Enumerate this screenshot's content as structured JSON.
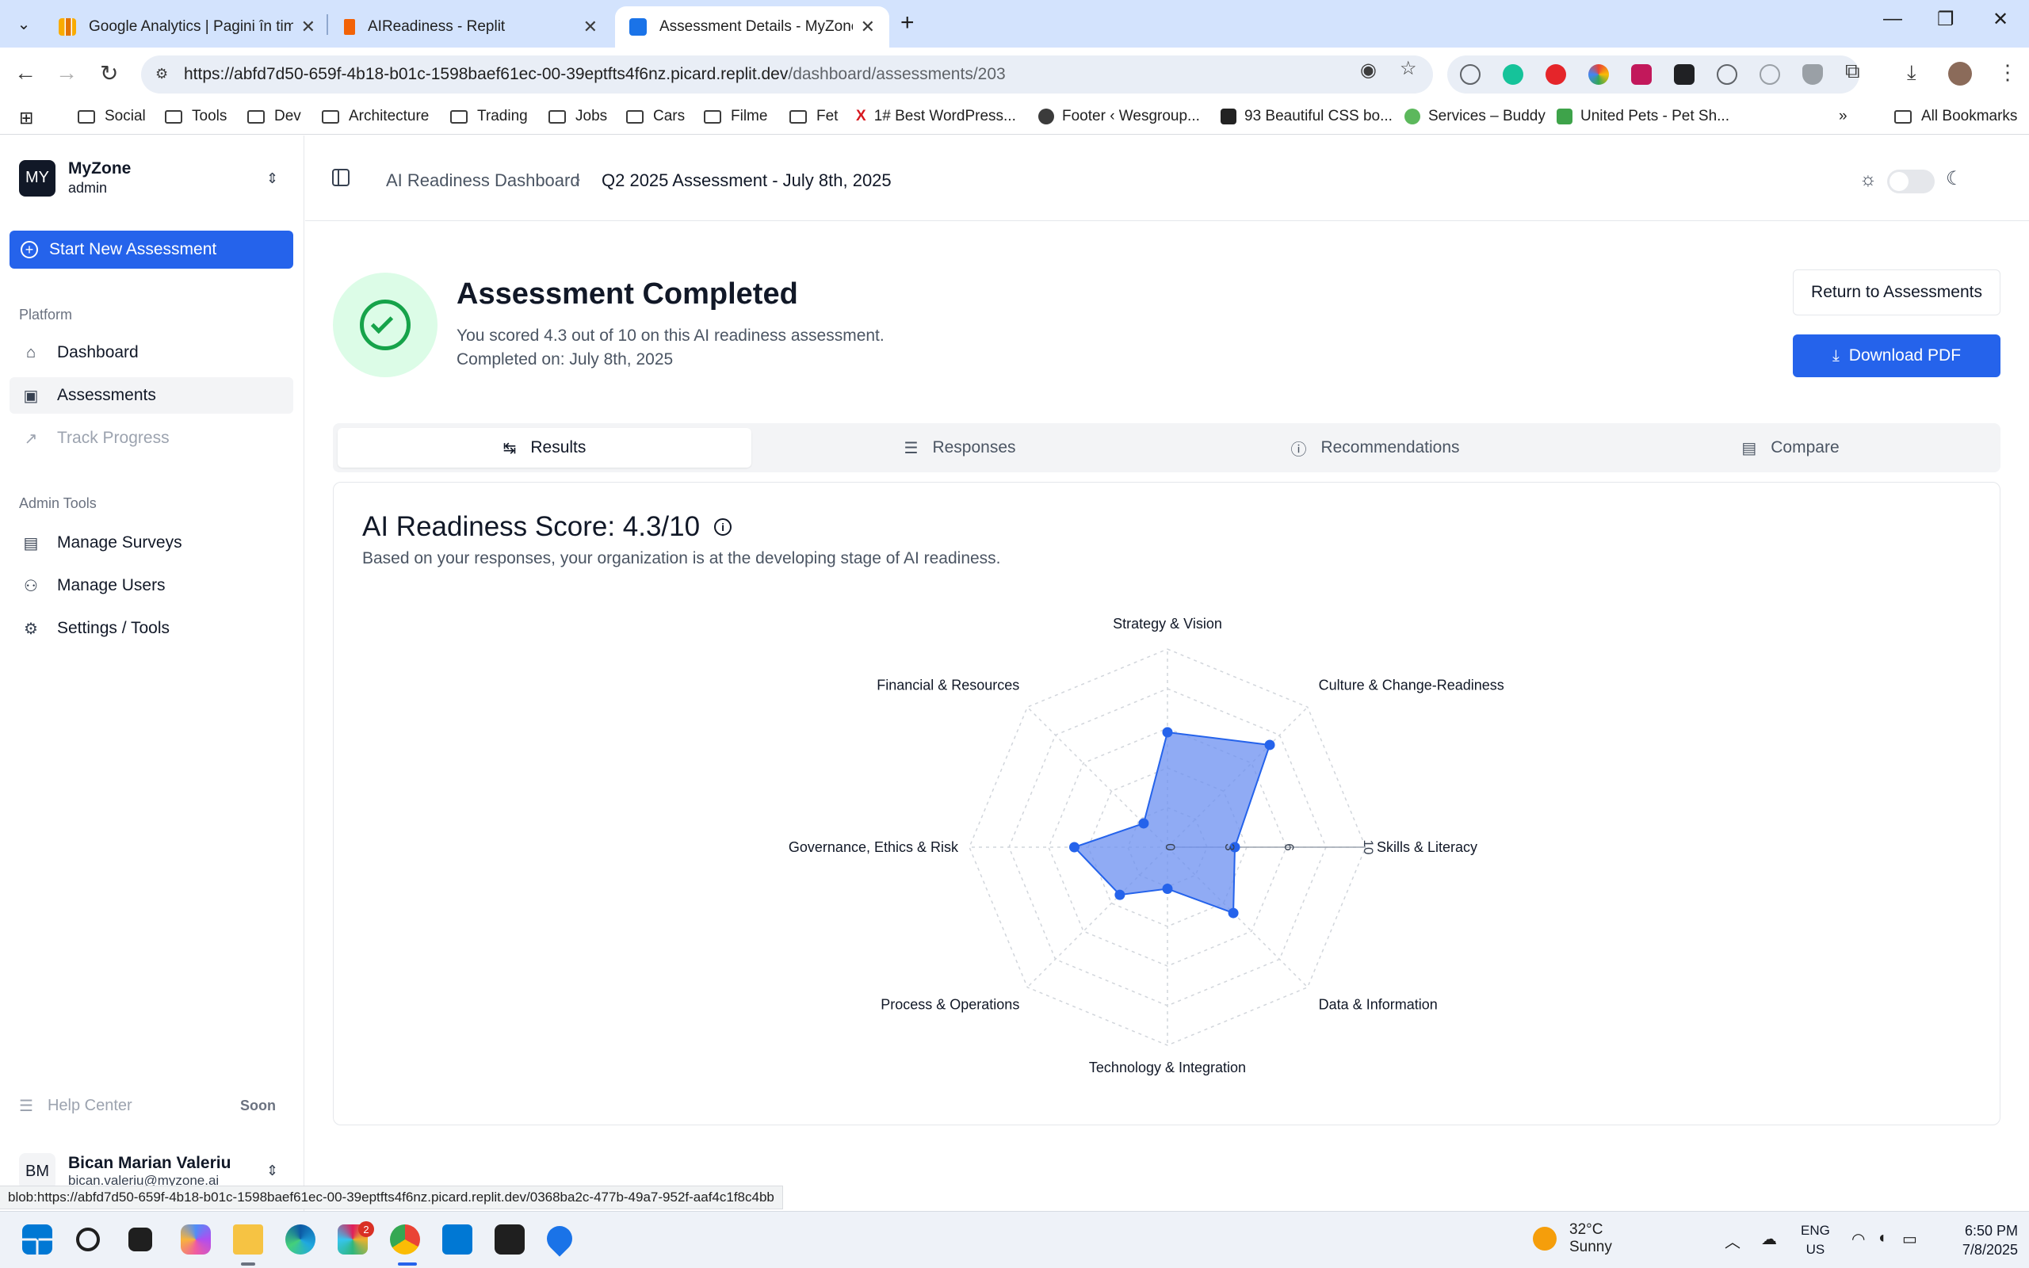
{
  "browser": {
    "tabs": [
      {
        "title": "Google Analytics | Pagini în tim",
        "favicon_color": "#f9ab00"
      },
      {
        "title": "AIReadiness - Replit",
        "favicon_color": "#f26207"
      },
      {
        "title": "Assessment Details - MyZone A",
        "favicon_color": "#1a73e8"
      }
    ],
    "url_host": "https://abfd7d50-659f-4b18-b01c-1598baef61ec-00-39eptfts4f6nz.picard.replit.dev",
    "url_path": "/dashboard/assessments/203",
    "bookmarks": [
      {
        "label": "Social",
        "type": "folder"
      },
      {
        "label": "Tools",
        "type": "folder"
      },
      {
        "label": "Dev",
        "type": "folder"
      },
      {
        "label": "Architecture",
        "type": "folder"
      },
      {
        "label": "Trading",
        "type": "folder"
      },
      {
        "label": "Jobs",
        "type": "folder"
      },
      {
        "label": "Cars",
        "type": "folder"
      },
      {
        "label": "Filme",
        "type": "folder"
      },
      {
        "label": "Fet",
        "type": "folder"
      },
      {
        "label": "1# Best WordPress...",
        "type": "site",
        "color": "#d71920"
      },
      {
        "label": "Footer ‹ Wesgroup...",
        "type": "site",
        "color": "#3b3b3b"
      },
      {
        "label": "93 Beautiful CSS bo...",
        "type": "site",
        "color": "#222222"
      },
      {
        "label": "Services – Buddy",
        "type": "site",
        "color": "#5cb85c"
      },
      {
        "label": "United Pets - Pet Sh...",
        "type": "site",
        "color": "#3ea34a"
      }
    ],
    "all_bookmarks": "All Bookmarks"
  },
  "sidebar": {
    "org_initials": "MY",
    "org_name": "MyZone",
    "org_role": "admin",
    "start_button": "Start New Assessment",
    "platform_label": "Platform",
    "platform_items": [
      {
        "label": "Dashboard",
        "icon": "home-icon"
      },
      {
        "label": "Assessments",
        "icon": "clipboard-icon"
      },
      {
        "label": "Track Progress",
        "icon": "trend-icon"
      }
    ],
    "admin_label": "Admin Tools",
    "admin_items": [
      {
        "label": "Manage Surveys",
        "icon": "survey-icon"
      },
      {
        "label": "Manage Users",
        "icon": "users-icon"
      },
      {
        "label": "Settings / Tools",
        "icon": "gear-icon"
      }
    ],
    "help_label": "Help Center",
    "help_badge": "Soon",
    "user_initials": "BM",
    "user_name": "Bican Marian Valeriu",
    "user_email": "bican.valeriu@myzone.ai"
  },
  "header": {
    "crumb_parent": "AI Readiness Dashboard",
    "crumb_current": "Q2 2025 Assessment - July 8th, 2025"
  },
  "summary": {
    "title": "Assessment Completed",
    "score_line": "You scored 4.3 out of 10 on this AI readiness assessment.",
    "completed_line": "Completed on: July 8th, 2025",
    "return_button": "Return to Assessments",
    "download_button": "Download PDF"
  },
  "tabs": [
    {
      "label": "Results",
      "icon": "↹"
    },
    {
      "label": "Responses",
      "icon": "☰"
    },
    {
      "label": "Recommendations",
      "icon": "ⓘ"
    },
    {
      "label": "Compare",
      "icon": "▤"
    }
  ],
  "results": {
    "score_title": "AI Readiness Score: 4.3/10",
    "score_sub": "Based on your responses, your organization is at the developing stage of AI readiness."
  },
  "chart_data": {
    "type": "radar",
    "categories": [
      "Strategy & Vision",
      "Culture & Change-Readiness",
      "Skills & Literacy",
      "Data & Information",
      "Technology & Integration",
      "Process & Operations",
      "Governance, Ethics & Risk",
      "Financial & Resources"
    ],
    "values": [
      5.8,
      7.3,
      3.4,
      4.7,
      2.1,
      3.4,
      4.7,
      1.7
    ],
    "rlim": [
      0,
      10
    ],
    "radial_ticks": [
      "0",
      "3",
      "6",
      "10"
    ],
    "fill_color": "#6b8ff0",
    "stroke_color": "#2563eb"
  },
  "statusbar": "blob:https://abfd7d50-659f-4b18-b01c-1598baef61ec-00-39eptfts4f6nz.picard.replit.dev/0368ba2c-477b-49a7-952f-aaf4c1f8c4bb",
  "taskbar": {
    "weather_temp": "32°C",
    "weather_desc": "Sunny",
    "lang_top": "ENG",
    "lang_bottom": "US",
    "time": "6:50 PM",
    "date": "7/8/2025",
    "slack_badge": "2"
  }
}
